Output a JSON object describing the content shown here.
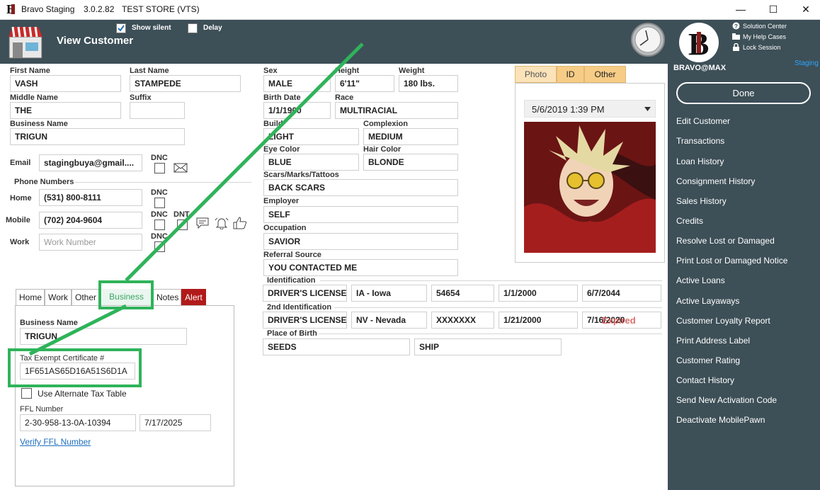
{
  "titlebar": {
    "app": "Bravo Staging",
    "version": "3.0.2.82",
    "store": "TEST STORE (VTS)",
    "minimize": "—",
    "maximize": "☐",
    "close": "✕"
  },
  "header": {
    "title": "View Customer",
    "show_silent": "Show silent",
    "delay": "Delay",
    "solution_center": "Solution Center",
    "help_cases": "My Help Cases",
    "lock_session": "Lock Session",
    "user": "BRAVO@MAX",
    "env": "Staging"
  },
  "labels": {
    "first_name": "First Name",
    "last_name": "Last Name",
    "middle_name": "Middle Name",
    "suffix": "Suffix",
    "business_name": "Business Name",
    "email": "Email",
    "dnc": "DNC",
    "dnt": "DNT",
    "phone_numbers": "Phone Numbers",
    "home": "Home",
    "mobile": "Mobile",
    "work": "Work",
    "sex": "Sex",
    "height": "Height",
    "weight": "Weight",
    "birth_date": "Birth Date",
    "race": "Race",
    "build": "Build",
    "complexion": "Complexion",
    "eye_color": "Eye Color",
    "hair_color": "Hair Color",
    "scars": "Scars/Marks/Tattoos",
    "employer": "Employer",
    "occupation": "Occupation",
    "referral": "Referral Source",
    "identification": "Identification",
    "second_id": "2nd Identification",
    "place_of_birth": "Place of Birth"
  },
  "customer": {
    "first_name": "VASH",
    "last_name": "STAMPEDE",
    "middle_name": "THE",
    "suffix": "",
    "business_name": "TRIGUN",
    "email": "stagingbuya@gmail....",
    "home_phone": "(531) 800-8111",
    "mobile_phone": "(702) 204-9604",
    "work_phone_placeholder": "Work Number",
    "sex": "MALE",
    "height": "6'11\"",
    "weight": "180 lbs.",
    "birth_date": "1/1/1900",
    "race": "MULTIRACIAL",
    "build": "LIGHT",
    "complexion": "MEDIUM",
    "eye_color": "BLUE",
    "hair_color": "BLONDE",
    "scars": "BACK SCARS",
    "employer": "SELF",
    "occupation": "SAVIOR",
    "referral": "YOU CONTACTED ME",
    "id1": {
      "type": "DRIVER'S LICENSE",
      "state": "IA - Iowa",
      "number": "54654",
      "issued": "1/1/2000",
      "expires": "6/7/2044"
    },
    "id2": {
      "type": "DRIVER'S LICENSE",
      "state": "NV - Nevada",
      "number": "XXXXXXX",
      "issued": "1/21/2000",
      "expires": "7/16/2020",
      "status": "Expired"
    },
    "birth_city": "SEEDS",
    "birth_country": "SHIP"
  },
  "tabs": [
    "Home",
    "Work",
    "Other",
    "Business",
    "Notes",
    "Alert"
  ],
  "business_tab": {
    "business_name_label": "Business Name",
    "business_name": "TRIGUN",
    "tax_label": "Tax Exempt Certificate #",
    "tax_number": "1F651AS65D16A51S6D1A",
    "alt_tax": "Use Alternate Tax Table",
    "ffl_label": "FFL Number",
    "ffl_number": "2-30-958-13-0A-10394",
    "ffl_date": "7/17/2025",
    "verify": "Verify FFL Number"
  },
  "photo_panel": {
    "tabs": [
      "Photo",
      "ID",
      "Other"
    ],
    "date": "5/6/2019 1:39 PM"
  },
  "sidebar": {
    "done": "Done",
    "items": [
      "Edit Customer",
      "Transactions",
      "Loan History",
      "Consignment History",
      "Sales History",
      "Credits",
      "Resolve Lost or Damaged",
      "Print Lost or Damaged Notice",
      "Active Loans",
      "Active Layaways",
      "Customer Loyalty Report",
      "Print Address Label",
      "Customer Rating",
      "Contact History",
      "Send New Activation Code",
      "Deactivate MobilePawn"
    ]
  },
  "colors": {
    "header": "#3d4f57",
    "alert_tab": "#b11a1a",
    "annotation": "#2fb35a",
    "photo_tab": "#f6cc86",
    "link": "#1f6fbf"
  }
}
